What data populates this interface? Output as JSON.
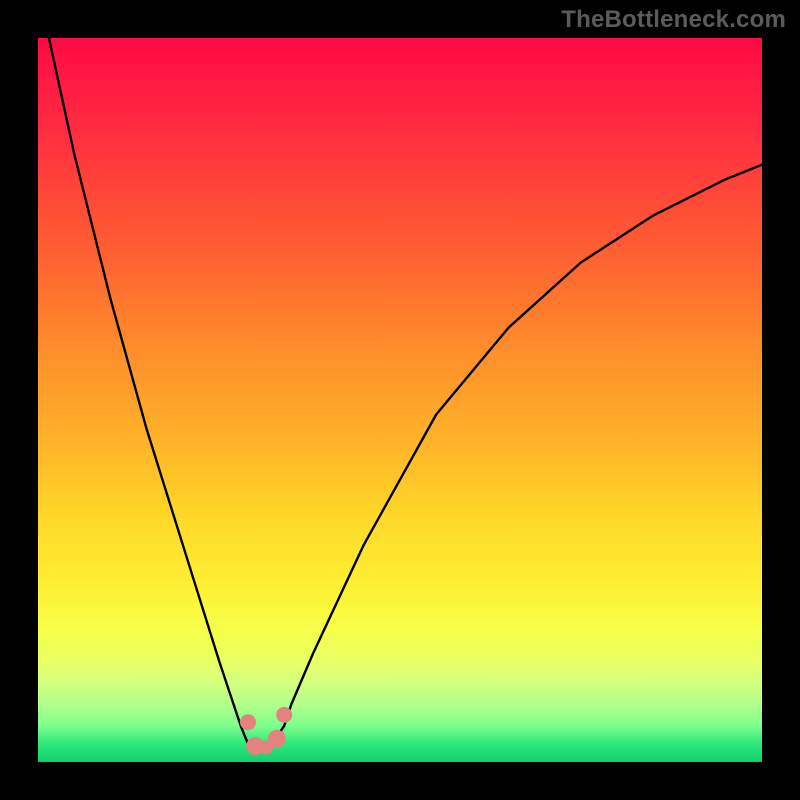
{
  "watermark": "TheBottleneck.com",
  "chart_data": {
    "type": "line",
    "title": "",
    "xlabel": "",
    "ylabel": "",
    "xlim": [
      0,
      100
    ],
    "ylim": [
      0,
      100
    ],
    "grid": false,
    "legend": false,
    "series": [
      {
        "name": "bottleneck-curve",
        "color": "#000000",
        "x": [
          1.5,
          5,
          10,
          15,
          20,
          25,
          28,
          29,
          29.5,
          30,
          31,
          32,
          33,
          34,
          35,
          38,
          45,
          55,
          65,
          75,
          85,
          95,
          100
        ],
        "y": [
          100,
          84,
          64,
          46,
          30,
          14,
          5,
          2.5,
          2,
          2,
          2,
          2.4,
          3.5,
          5,
          8,
          15,
          30,
          48,
          60,
          69,
          75.5,
          80.5,
          82.5
        ]
      }
    ],
    "markers": [
      {
        "name": "marker-left-tip",
        "shape": "rounded-dot",
        "color": "#e4827f",
        "x": 29,
        "y": 5.5,
        "size": 16
      },
      {
        "name": "marker-left-base",
        "shape": "rounded-dot",
        "color": "#e4827f",
        "x": 30,
        "y": 2.2,
        "size": 18
      },
      {
        "name": "marker-mid",
        "shape": "rounded-dot",
        "color": "#e4827f",
        "x": 31.5,
        "y": 2.0,
        "size": 14
      },
      {
        "name": "marker-right-base",
        "shape": "rounded-dot",
        "color": "#e4827f",
        "x": 33,
        "y": 3.2,
        "size": 18
      },
      {
        "name": "marker-right-tip",
        "shape": "rounded-dot",
        "color": "#e4827f",
        "x": 34,
        "y": 6.5,
        "size": 16
      }
    ],
    "gradient_stops": [
      {
        "pos": 0,
        "color": "#ff0a45"
      },
      {
        "pos": 0.5,
        "color": "#ffb129"
      },
      {
        "pos": 0.8,
        "color": "#fdf134"
      },
      {
        "pos": 1.0,
        "color": "#0fcf6e"
      }
    ]
  }
}
